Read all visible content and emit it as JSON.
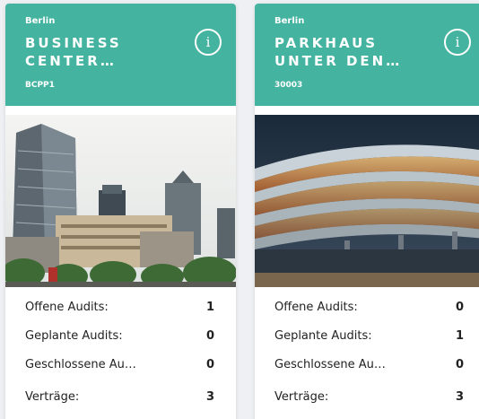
{
  "cards": [
    {
      "city": "Berlin",
      "title": "BUSINESS CENTER…",
      "code": "BCPP1",
      "image": "city-skyline-image",
      "stats": [
        {
          "label": "Offene Audits:",
          "value": "1"
        },
        {
          "label": "Geplante Audits:",
          "value": "0"
        },
        {
          "label": "Geschlossene Au…",
          "value": "0"
        },
        {
          "label": "Verträge:",
          "value": "3"
        }
      ]
    },
    {
      "city": "Berlin",
      "title": "PARKHAUS UNTER DEN…",
      "code": "30003",
      "image": "parking-garage-image",
      "stats": [
        {
          "label": "Offene Audits:",
          "value": "0"
        },
        {
          "label": "Geplante Audits:",
          "value": "1"
        },
        {
          "label": "Geschlossene Au…",
          "value": "0"
        },
        {
          "label": "Verträge:",
          "value": "3"
        }
      ]
    }
  ],
  "colors": {
    "header": "#44b3a0",
    "header_text": "#ffffff",
    "body_text": "#222222"
  },
  "icons": {
    "info": "info-circle-icon"
  }
}
